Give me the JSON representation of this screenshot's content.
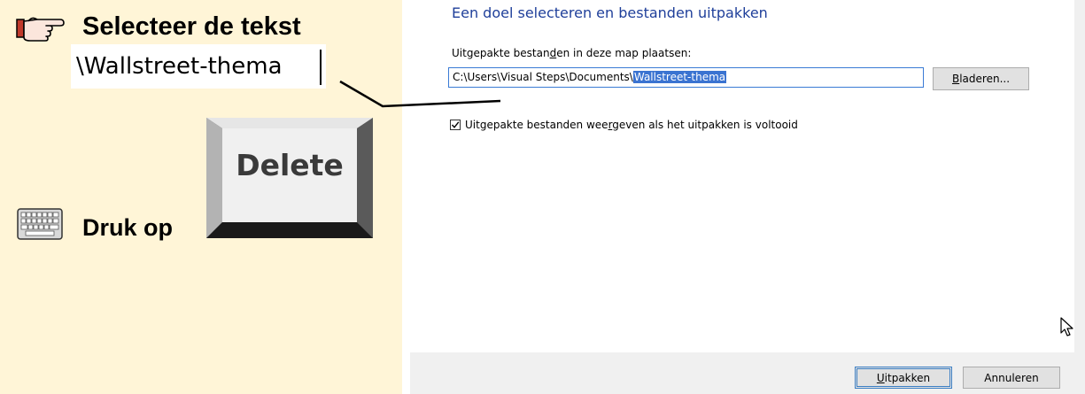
{
  "instructions": {
    "step1": "Selecteer de tekst",
    "snippet_text": "\\Wallstreet-thema",
    "delete_key": "Delete",
    "step2": "Druk op"
  },
  "dialog": {
    "title": "Een doel selecteren en bestanden uitpakken",
    "path_label_pre": "Uitgepakte bestan",
    "path_label_u": "d",
    "path_label_post": "en in deze map plaatsen:",
    "path_prefix": "C:\\Users\\Visual Steps\\Documents\\",
    "path_selected": "Wallstreet-thema",
    "browse_u": "B",
    "browse_rest": "laderen...",
    "checkbox_checked": true,
    "checkbox_label_pre": "Uitgepakte bestanden wee",
    "checkbox_label_u": "r",
    "checkbox_label_post": "geven als het uitpakken is voltooid",
    "extract_u": "U",
    "extract_rest": "itpakken",
    "cancel": "Annuleren"
  },
  "icons": {
    "pointer": "pointing-hand-icon",
    "keyboard": "keyboard-icon",
    "cursor": "mouse-cursor-icon"
  },
  "colors": {
    "instruction_bg": "#fff5d7",
    "dialog_title": "#1f3f9a",
    "selection": "#3a73d1",
    "footer": "#f0f0f0"
  }
}
